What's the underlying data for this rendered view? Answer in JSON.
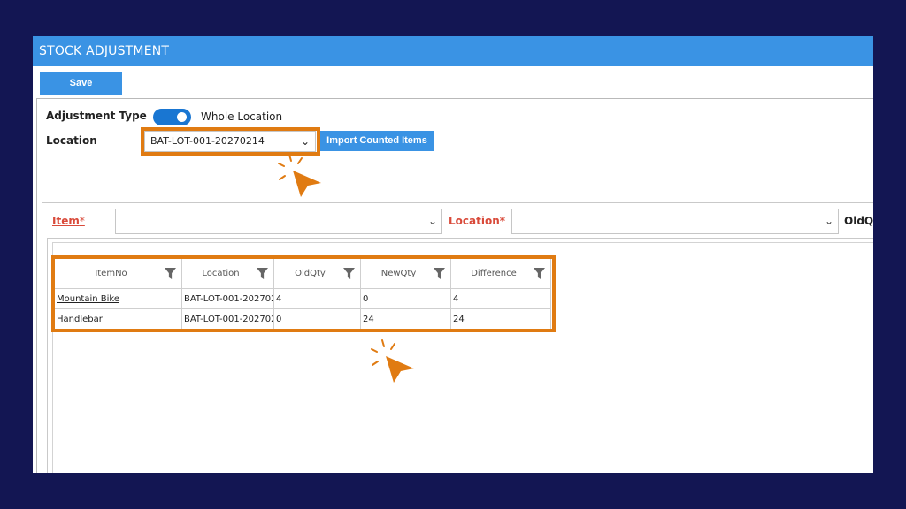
{
  "window": {
    "title": "STOCK ADJUSTMENT"
  },
  "toolbar": {
    "save_label": "Save"
  },
  "form": {
    "adjustment_type_label": "Adjustment Type",
    "adjustment_type_value": "Whole Location",
    "adjustment_type_on": true,
    "location_label": "Location",
    "location_value": "BAT-LOT-001-20270214",
    "import_label": "Import Counted Items"
  },
  "item_row": {
    "item_label": "Item",
    "item_required": "*",
    "location_label": "Location*",
    "oldqty_label": "OldQty"
  },
  "grid": {
    "columns": [
      "ItemNo",
      "Location",
      "OldQty",
      "NewQty",
      "Difference"
    ],
    "rows": [
      {
        "item": "Mountain Bike",
        "location": "BAT-LOT-001-202702",
        "oldqty": "4",
        "newqty": "0",
        "difference": "4"
      },
      {
        "item": "Handlebar",
        "location": "BAT-LOT-001-202702",
        "oldqty": "0",
        "newqty": "24",
        "difference": "24"
      }
    ]
  },
  "icons": {
    "dropdown": "chevron-down-icon",
    "filter": "funnel-icon",
    "cursor": "click-cursor-icon"
  },
  "colors": {
    "background": "#131653",
    "accent": "#3a93e4",
    "toggle": "#1976d2",
    "highlight": "#e07b12",
    "required": "#d94a3a"
  }
}
